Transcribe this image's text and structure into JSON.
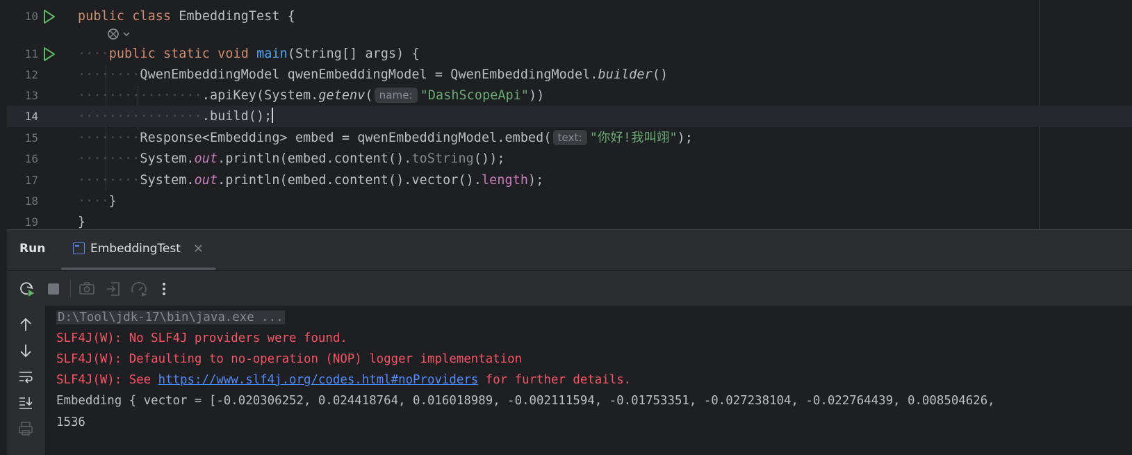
{
  "editor": {
    "lines": [
      {
        "num": "10",
        "run": true
      },
      {
        "num": "11",
        "run": true
      },
      {
        "num": "12"
      },
      {
        "num": "13"
      },
      {
        "num": "14",
        "current": true
      },
      {
        "num": "15"
      },
      {
        "num": "16"
      },
      {
        "num": "17"
      },
      {
        "num": "18"
      },
      {
        "num": "19"
      }
    ],
    "tokens": {
      "l10_public": "public",
      "l10_class": "class",
      "l10_name": "EmbeddingTest",
      "l10_brace": "{",
      "l11_ws": "····",
      "l11_public": "public",
      "l11_static": "static",
      "l11_void": "void",
      "l11_main": "main",
      "l11_params": "(String[] args) {",
      "l12_ws": "········",
      "l12_a": "QwenEmbeddingModel qwenEmbeddingModel = QwenEmbeddingModel.",
      "l12_builder": "builder",
      "l12_b": "()",
      "l13_ws": "················",
      "l13_a": ".apiKey(System.",
      "l13_getenv": "getenv",
      "l13_paren": "(",
      "l13_hint": "name:",
      "l13_str": "\"DashScopeApi\"",
      "l13_end": "))",
      "l14_ws": "················",
      "l14_a": ".build();",
      "l15_ws": "········",
      "l15_a": "Response<Embedding> embed = qwenEmbeddingModel.embed(",
      "l15_hint": "text:",
      "l15_str": "\"你好!我叫翊\"",
      "l15_end": ");",
      "l16_ws": "········",
      "l16_a": "System.",
      "l16_out": "out",
      "l16_b": ".println(embed.content().",
      "l16_tostring": "toString",
      "l16_c": "());",
      "l17_ws": "········",
      "l17_a": "System.",
      "l17_out": "out",
      "l17_b": ".println(embed.content().vector().",
      "l17_length": "length",
      "l17_c": ");",
      "l18_ws": "····",
      "l18_brace": "}",
      "l19_brace": "}"
    }
  },
  "run_panel": {
    "title": "Run",
    "tab_label": "EmbeddingTest",
    "tab_close": "×"
  },
  "console": {
    "cmd": "D:\\Tool\\jdk-17\\bin\\java.exe ...",
    "err1": "SLF4J(W): No SLF4J providers were found.",
    "err2": "SLF4J(W): Defaulting to no-operation (NOP) logger implementation",
    "err3_pre": "SLF4J(W): See ",
    "err3_link": "https://www.slf4j.org/codes.html#noProviders",
    "err3_post": " for further details.",
    "out1": "Embedding { vector = [-0.020306252, 0.024418764, 0.016018989, -0.002111594, -0.01753351, -0.027238104, -0.022764439, 0.008504626,",
    "out2": "1536"
  },
  "icons": {
    "toolbar": [
      "rerun-icon",
      "stop-icon",
      "camera-icon",
      "exit-icon",
      "profiler-icon",
      "more-icon"
    ],
    "left_bar": [
      "up-arrow-icon",
      "down-arrow-icon",
      "soft-wrap-icon",
      "scroll-to-end-icon",
      "print-icon"
    ]
  },
  "colors": {
    "background": "#1e1f22",
    "panel": "#2b2d30",
    "keyword": "#cf8e6d",
    "function": "#56a8f5",
    "string": "#6aab73",
    "field": "#c77dbb",
    "error": "#f75464",
    "link": "#548af7",
    "run_green": "#5fb865"
  }
}
